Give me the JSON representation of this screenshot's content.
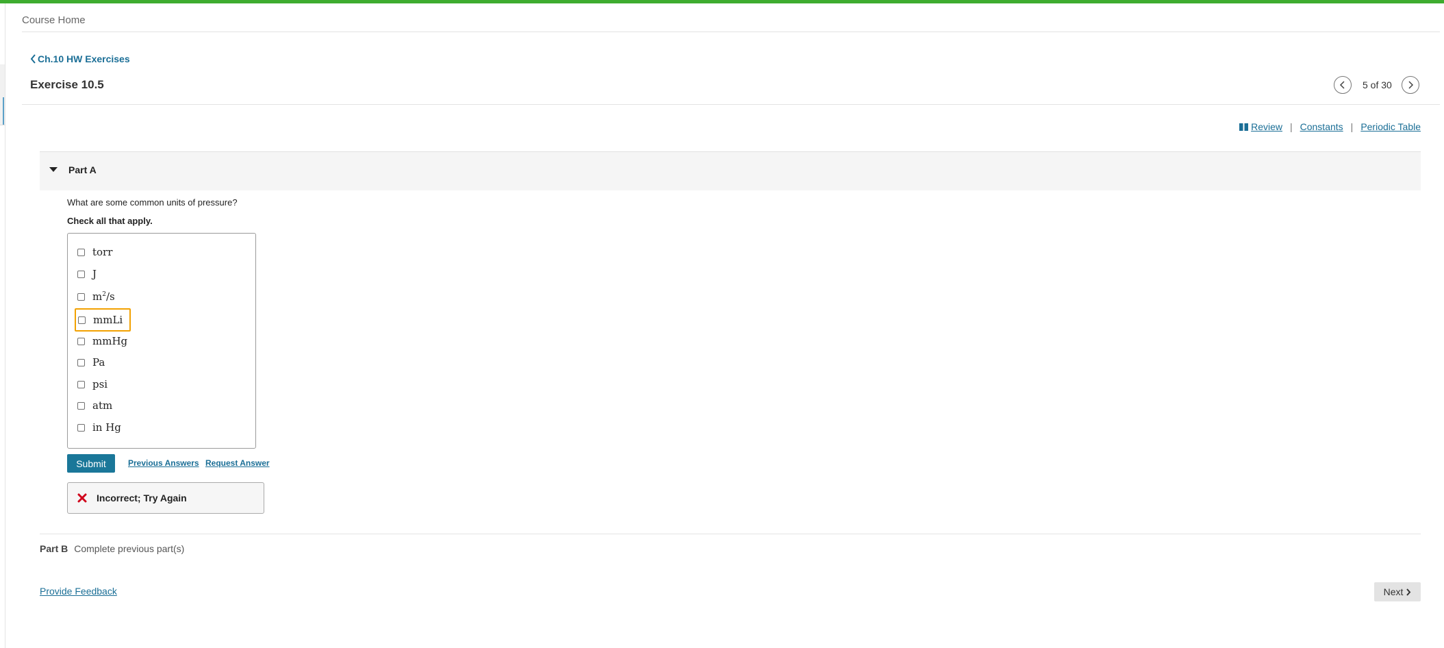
{
  "header": {
    "course_home": "Course Home",
    "back_link": "Ch.10 HW Exercises",
    "exercise_title": "Exercise 10.5",
    "pager": {
      "current": 5,
      "total": 30,
      "text": "5 of 30"
    }
  },
  "resources": {
    "review": "Review",
    "constants": "Constants",
    "periodic_table": "Periodic Table",
    "separator": "|"
  },
  "part_a": {
    "label": "Part A",
    "question": "What are some common units of pressure?",
    "instruction": "Check all that apply.",
    "choices": [
      "torr",
      "J",
      "m",
      "mmLi",
      "mmHg",
      "Pa",
      "psi",
      "atm",
      "in Hg"
    ],
    "choice_m2s_suffix": "/s",
    "choice_m2s_exp": "2",
    "submit_label": "Submit",
    "previous_answers": "Previous Answers",
    "request_answer": "Request Answer",
    "feedback": "Incorrect; Try Again"
  },
  "part_b": {
    "label": "Part B",
    "status": "Complete previous part(s)"
  },
  "footer": {
    "provide_feedback": "Provide Feedback",
    "next": "Next"
  },
  "colors": {
    "top_bar": "#3eac2f",
    "link": "#1a6e96",
    "submit": "#1a7799",
    "error": "#d0021b",
    "focus": "#f2a100"
  },
  "icons": {
    "back": "chevron-left-icon",
    "prev": "chevron-left-icon",
    "next": "chevron-right-icon",
    "review": "book-icon",
    "part_toggle": "caret-down-icon",
    "feedback": "x-mark-icon"
  }
}
